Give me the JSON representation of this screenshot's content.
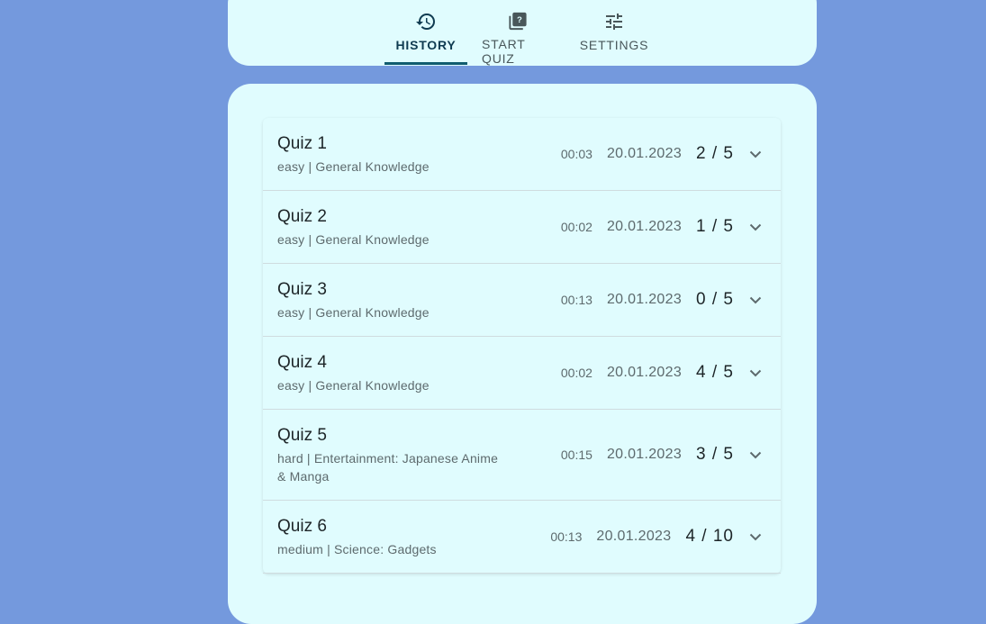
{
  "nav": {
    "tabs": [
      {
        "label": "HISTORY",
        "icon": "history-icon",
        "active": true
      },
      {
        "label": "START QUIZ",
        "icon": "quiz-icon",
        "active": false
      },
      {
        "label": "SETTINGS",
        "icon": "tune-icon",
        "active": false
      }
    ]
  },
  "history": {
    "quizzes": [
      {
        "title": "Quiz 1",
        "subtitle": "easy | General Knowledge",
        "time": "00:03",
        "date": "20.01.2023",
        "score": "2 / 5"
      },
      {
        "title": "Quiz 2",
        "subtitle": "easy | General Knowledge",
        "time": "00:02",
        "date": "20.01.2023",
        "score": "1 / 5"
      },
      {
        "title": "Quiz 3",
        "subtitle": "easy | General Knowledge",
        "time": "00:13",
        "date": "20.01.2023",
        "score": "0 / 5"
      },
      {
        "title": "Quiz 4",
        "subtitle": "easy | General Knowledge",
        "time": "00:02",
        "date": "20.01.2023",
        "score": "4 / 5"
      },
      {
        "title": "Quiz 5",
        "subtitle": "hard | Entertainment: Japanese Anime & Manga",
        "time": "00:15",
        "date": "20.01.2023",
        "score": "3 / 5"
      },
      {
        "title": "Quiz 6",
        "subtitle": "medium | Science: Gadgets",
        "time": "00:13",
        "date": "20.01.2023",
        "score": "4 / 10"
      }
    ]
  },
  "colors": {
    "background": "#7499dd",
    "card": "#e0fcfe",
    "accent": "#0f5c6f"
  }
}
